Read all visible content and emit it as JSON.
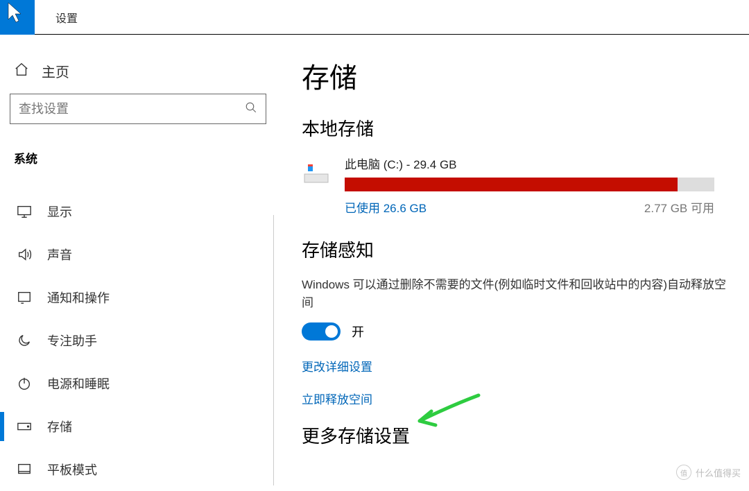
{
  "app": {
    "title": "设置"
  },
  "sidebar": {
    "home": "主页",
    "search_placeholder": "查找设置",
    "category": "系统",
    "items": [
      {
        "label": "显示",
        "icon": "monitor-icon"
      },
      {
        "label": "声音",
        "icon": "sound-icon"
      },
      {
        "label": "通知和操作",
        "icon": "notification-icon"
      },
      {
        "label": "专注助手",
        "icon": "moon-icon"
      },
      {
        "label": "电源和睡眠",
        "icon": "power-icon"
      },
      {
        "label": "存储",
        "icon": "storage-icon",
        "selected": true
      },
      {
        "label": "平板模式",
        "icon": "tablet-icon"
      }
    ]
  },
  "main": {
    "title": "存储",
    "local_storage_title": "本地存储",
    "disk": {
      "name": "此电脑 (C:) - 29.4 GB",
      "used_label": "已使用 26.6 GB",
      "free_label": "2.77 GB 可用",
      "used_pct": 90
    },
    "sense": {
      "title": "存储感知",
      "desc": "Windows 可以通过删除不需要的文件(例如临时文件和回收站中的内容)自动释放空间",
      "toggle_state": "开",
      "link_details": "更改详细设置",
      "link_freeup": "立即释放空间"
    },
    "more_title": "更多存储设置"
  },
  "watermark": "什么值得买"
}
